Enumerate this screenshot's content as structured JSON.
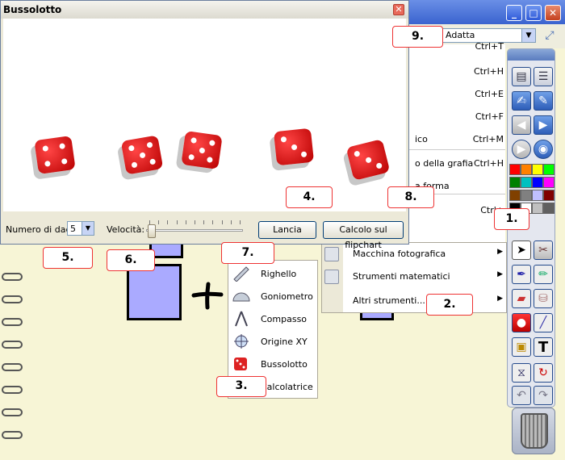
{
  "dialog": {
    "title": "Bussolotto",
    "close_glyph": "✕",
    "dice_count_label": "Numero di dadi",
    "dice_count_value": "5",
    "speed_label": "Velocità:",
    "speed_level_fraction": 0.02,
    "roll_button": "Lancia",
    "flipchart_button": "Calcolo sul flipchart",
    "dice_faces": [
      4,
      5,
      5,
      3,
      3
    ]
  },
  "window_controls": [
    "minimize-icon",
    "maximize-icon",
    "close-icon"
  ],
  "zoom_select": {
    "value": "Adatta"
  },
  "background_menu": [
    {
      "label": "",
      "shortcut": "Ctrl+T"
    },
    {
      "label": "",
      "shortcut": "Ctrl+H"
    },
    {
      "label": "",
      "shortcut": "Ctrl+E"
    },
    {
      "label": "",
      "shortcut": "Ctrl+F"
    },
    {
      "label": "ico",
      "shortcut": "Ctrl+M"
    },
    {
      "label": "o della grafia",
      "shortcut": "Ctrl+H"
    },
    {
      "label": "a forma",
      "shortcut": ""
    },
    {
      "label": "",
      "shortcut": "Ctrl+"
    }
  ],
  "tools_menu": [
    {
      "label": "Macchina fotografica",
      "icon": "camera-icon"
    },
    {
      "label": "Strumenti matematici",
      "icon": "calculator-icon"
    },
    {
      "label": "Altri strumenti...",
      "icon": ""
    }
  ],
  "math_menu": [
    {
      "label": "Righello",
      "icon": "ruler-icon"
    },
    {
      "label": "Goniometro",
      "icon": "protractor-icon"
    },
    {
      "label": "Compasso",
      "icon": "compass-icon"
    },
    {
      "label": "Origine XY",
      "icon": "xy-origin-icon"
    },
    {
      "label": "Bussolotto",
      "icon": "dice-icon"
    },
    {
      "label": "Calcolatrice",
      "icon": "calculator-icon"
    }
  ],
  "palette_colors": [
    "#ff0000",
    "#ff8000",
    "#ffff00",
    "#00ff00",
    "#008000",
    "#00c0c0",
    "#0000ff",
    "#ff00ff",
    "#804000",
    "#808080",
    "#c0c0ff",
    "#800000",
    "#000000",
    "#ffffff",
    "#c0c0c0",
    "#606060"
  ],
  "callouts": [
    "1.",
    "2.",
    "3.",
    "4.",
    "5.",
    "6.",
    "7.",
    "8.",
    "9."
  ],
  "colors": {
    "callout_border": "#e33333",
    "die_red": "#d40000",
    "shape_fill": "#aaaaff"
  }
}
